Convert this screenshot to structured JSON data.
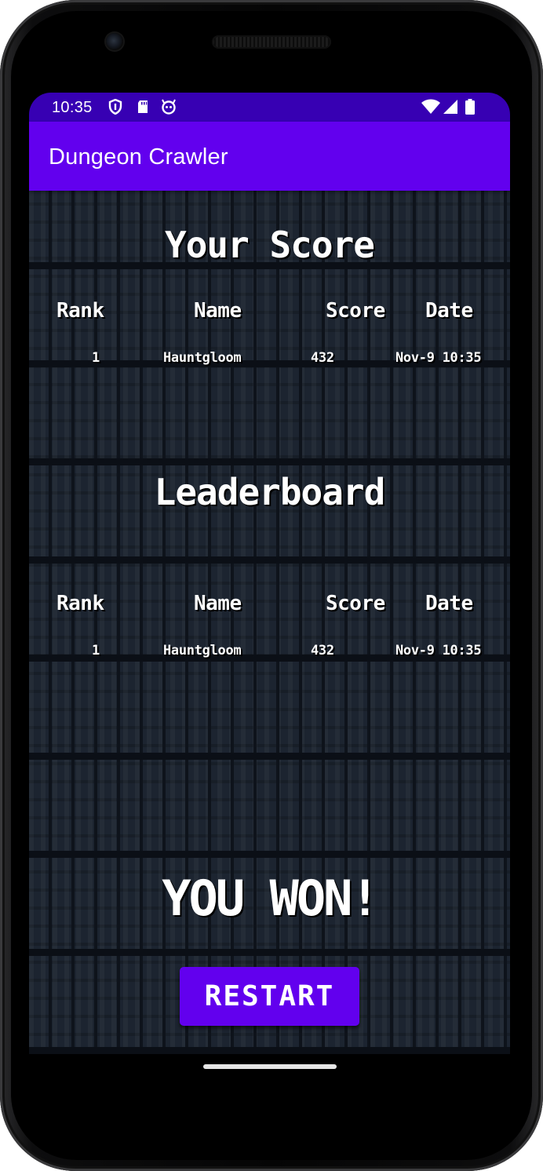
{
  "status_bar": {
    "time": "10:35",
    "left_icons": [
      "shield-icon",
      "sd-card-icon",
      "face-icon"
    ],
    "right_icons": [
      "wifi-icon",
      "signal-icon",
      "battery-icon"
    ]
  },
  "app_bar": {
    "title": "Dungeon Crawler"
  },
  "your_score": {
    "title": "Your Score",
    "headers": [
      "Rank",
      "Name",
      "Score",
      "Date"
    ],
    "rows": [
      {
        "rank": "1",
        "name": "Hauntgloom",
        "score": "432",
        "date": "Nov-9 10:35"
      }
    ]
  },
  "leaderboard": {
    "title": "Leaderboard",
    "headers": [
      "Rank",
      "Name",
      "Score",
      "Date"
    ],
    "rows": [
      {
        "rank": "1",
        "name": "Hauntgloom",
        "score": "432",
        "date": "Nov-9 10:35"
      }
    ]
  },
  "result_text": "YOU WON!",
  "restart_label": "RESTART",
  "colors": {
    "primary": "#6200ee",
    "primary_dark": "#3700b3",
    "dungeon_background": "#1c2430"
  }
}
